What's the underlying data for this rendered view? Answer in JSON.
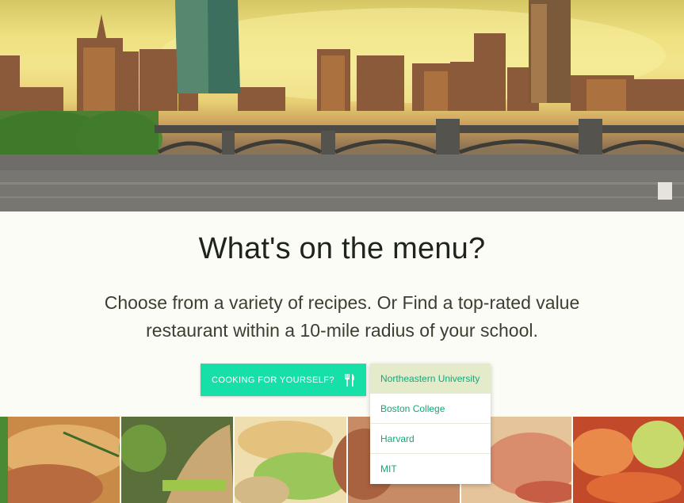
{
  "hero": {
    "image": "boston-skyline-photo"
  },
  "menu": {
    "title": "What's on the menu?",
    "subtitle": "Choose from a variety of recipes. Or Find a top-rated value restaurant within a 10-mile radius of your school.",
    "cook_button_label": "COOKING FOR YOURSELF?",
    "cook_button_icon": "utensils-icon"
  },
  "schools": {
    "selected_index": 0,
    "options": [
      "Northeastern University",
      "Boston College",
      "Harvard",
      "MIT"
    ]
  },
  "food_strip": {
    "image": "food-photo-collage"
  },
  "colors": {
    "accent": "#16e0a8",
    "link": "#14a77a",
    "selected_bg": "#e3ebcb",
    "page_bg": "#fbfcf6"
  }
}
